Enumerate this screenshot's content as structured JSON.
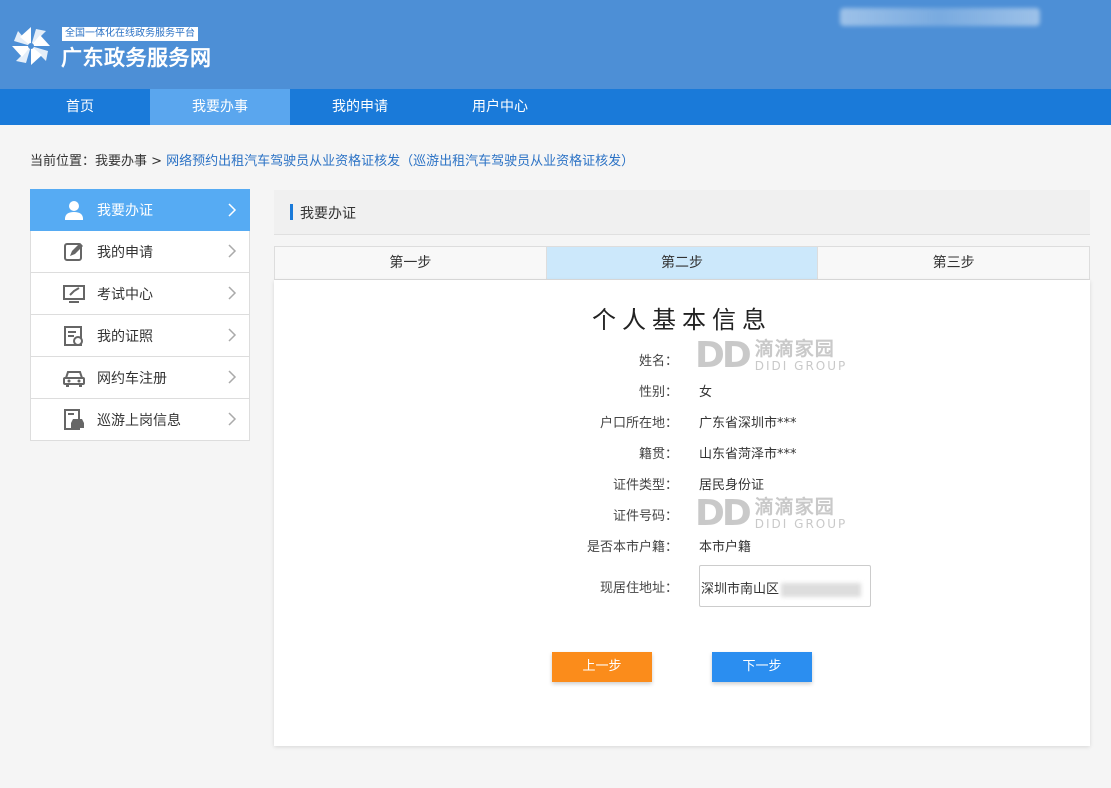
{
  "header": {
    "tagline": "全国一体化在线政务服务平台",
    "site_name": "广东政务服务网",
    "logo_icon": "pinwheel-logo-icon"
  },
  "nav": {
    "items": [
      {
        "label": "首页",
        "active": false
      },
      {
        "label": "我要办事",
        "active": true
      },
      {
        "label": "我的申请",
        "active": false
      },
      {
        "label": "用户中心",
        "active": false
      }
    ]
  },
  "breadcrumb": {
    "prefix": "当前位置：我要办事 >",
    "current": "网络预约出租汽车驾驶员从业资格证核发（巡游出租汽车驾驶员从业资格证核发）"
  },
  "sidebar": {
    "items": [
      {
        "label": "我要办证",
        "icon": "user-icon",
        "active": true
      },
      {
        "label": "我的申请",
        "icon": "edit-icon",
        "active": false
      },
      {
        "label": "考试中心",
        "icon": "monitor-icon",
        "active": false
      },
      {
        "label": "我的证照",
        "icon": "certificate-icon",
        "active": false
      },
      {
        "label": "网约车注册",
        "icon": "car-icon",
        "active": false
      },
      {
        "label": "巡游上岗信息",
        "icon": "taxi-card-icon",
        "active": false
      }
    ]
  },
  "main": {
    "section_title": "我要办证",
    "steps": [
      {
        "label": "第一步",
        "active": false
      },
      {
        "label": "第二步",
        "active": true
      },
      {
        "label": "第三步",
        "active": false
      }
    ],
    "form_title": "个人基本信息",
    "fields": {
      "name_label": "姓名：",
      "gender_label": "性别：",
      "gender_value": "女",
      "hukou_label": "户口所在地：",
      "hukou_value": "广东省深圳市***",
      "origin_label": "籍贯：",
      "origin_value": "山东省菏泽市***",
      "id_type_label": "证件类型：",
      "id_type_value": "居民身份证",
      "id_no_label": "证件号码：",
      "local_label": "是否本市户籍：",
      "local_value": "本市户籍",
      "address_label": "现居住地址：",
      "address_value": "深圳市南山区"
    },
    "watermark": {
      "logo": "DD",
      "cn": "滴滴家园",
      "en": "DIDI GROUP"
    },
    "buttons": {
      "prev_label": "上一步",
      "next_label": "下一步"
    }
  },
  "colors": {
    "header_bg": "#4d8fd6",
    "nav_bg": "#1a7ad9",
    "nav_active": "#5aa6ee",
    "sidebar_active": "#56abf3",
    "step_active": "#cce8fb",
    "prev_button": "#fb8c1b",
    "next_button": "#2b8ef0"
  }
}
